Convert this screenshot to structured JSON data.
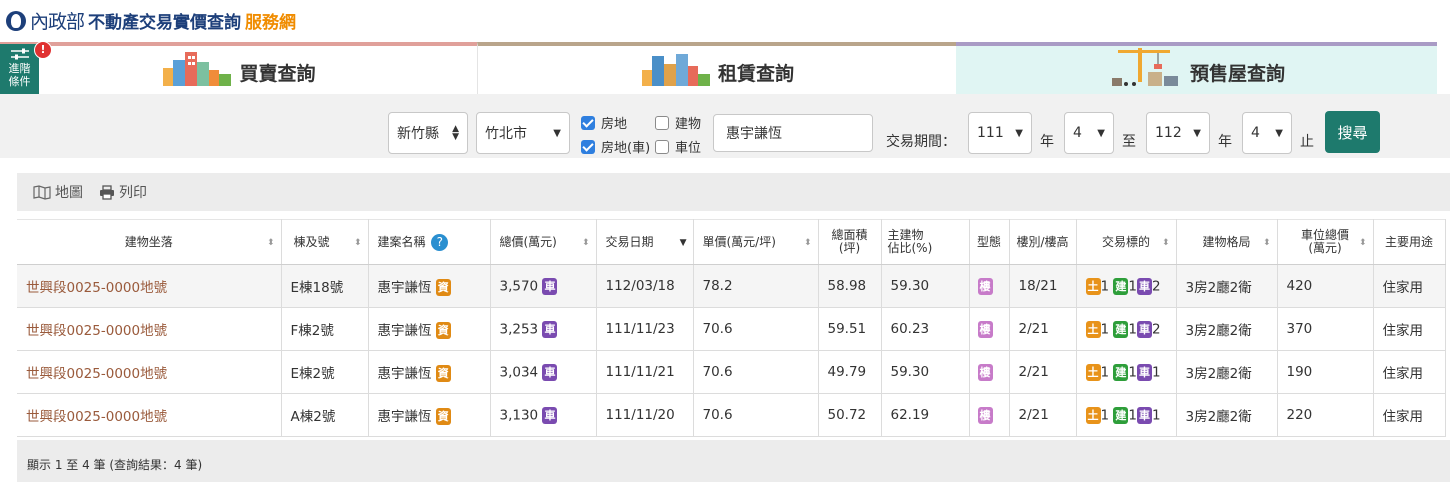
{
  "header": {
    "ministry": "內政部",
    "site_title": "不動產交易實價查詢",
    "site_suffix": "服務網"
  },
  "tabs": [
    {
      "label": "買賣查詢",
      "accent": "#e0a09a"
    },
    {
      "label": "租賃查詢",
      "accent": "#b9a58b"
    },
    {
      "label": "預售屋查詢",
      "accent": "#a99bc5"
    }
  ],
  "advanced": {
    "label_line1": "進階",
    "label_line2": "條件",
    "badge": "!"
  },
  "search": {
    "county": "新竹縣",
    "city": "竹北市",
    "checkboxes": [
      {
        "label": "房地",
        "checked": true
      },
      {
        "label": "建物",
        "checked": false
      },
      {
        "label": "房地(車)",
        "checked": true
      },
      {
        "label": "車位",
        "checked": false
      }
    ],
    "keyword": "惠宇謙恆",
    "period_label": "交易期間：",
    "from_year": "111",
    "year_unit": "年",
    "from_month": "4",
    "to_label": "至",
    "to_year": "112",
    "to_month": "4",
    "end_label": "止",
    "submit_label": "搜尋"
  },
  "toolbar": {
    "map_label": "地圖",
    "print_label": "列印"
  },
  "table": {
    "headers": [
      "建物坐落",
      "棟及號",
      "建案名稱",
      "總價(萬元)",
      "交易日期",
      "單價(萬元/坪)",
      "總面積\n(坪)",
      "主建物\n佔比(%)",
      "型態",
      "樓別/樓高",
      "交易標的",
      "建物格局",
      "車位總價\n(萬元)",
      "主要用途"
    ],
    "rows": [
      {
        "address": "世興段0025-0000地號",
        "unit": "E棟18號",
        "project": "惠宇謙恆",
        "total": "3,570",
        "date": "112/03/18",
        "unit_price": "78.2",
        "area": "58.98",
        "main_ratio": "59.30",
        "type": "樓",
        "floor": "18/21",
        "land": "1",
        "bld": "1",
        "park": "2",
        "layout": "3房2廳2衛",
        "park_price": "420",
        "use": "住家用"
      },
      {
        "address": "世興段0025-0000地號",
        "unit": "F棟2號",
        "project": "惠宇謙恆",
        "total": "3,253",
        "date": "111/11/23",
        "unit_price": "70.6",
        "area": "59.51",
        "main_ratio": "60.23",
        "type": "樓",
        "floor": "2/21",
        "land": "1",
        "bld": "1",
        "park": "2",
        "layout": "3房2廳2衛",
        "park_price": "370",
        "use": "住家用"
      },
      {
        "address": "世興段0025-0000地號",
        "unit": "E棟2號",
        "project": "惠宇謙恆",
        "total": "3,034",
        "date": "111/11/21",
        "unit_price": "70.6",
        "area": "49.79",
        "main_ratio": "59.30",
        "type": "樓",
        "floor": "2/21",
        "land": "1",
        "bld": "1",
        "park": "1",
        "layout": "3房2廳2衛",
        "park_price": "190",
        "use": "住家用"
      },
      {
        "address": "世興段0025-0000地號",
        "unit": "A棟2號",
        "project": "惠宇謙恆",
        "total": "3,130",
        "date": "111/11/20",
        "unit_price": "70.6",
        "area": "50.72",
        "main_ratio": "62.19",
        "type": "樓",
        "floor": "2/21",
        "land": "1",
        "bld": "1",
        "park": "1",
        "layout": "3房2廳2衛",
        "park_price": "220",
        "use": "住家用"
      }
    ],
    "tag_car": "車",
    "tag_info": "資",
    "tag_land": "土",
    "tag_bld": "建",
    "tag_park": "車"
  },
  "footer": {
    "summary": "顯示 1 至 4 筆 (查詢結果：4 筆)"
  }
}
